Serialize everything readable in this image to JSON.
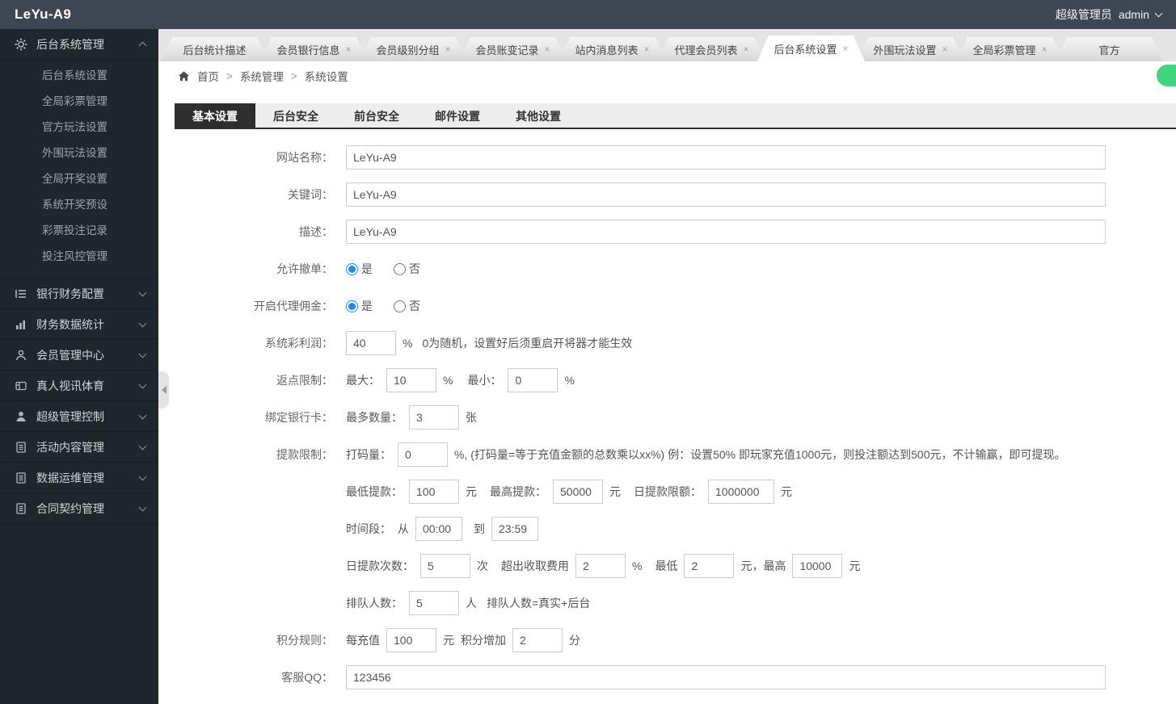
{
  "topbar": {
    "brand": "LeYu-A9",
    "role": "超级管理员",
    "username": "admin"
  },
  "tabbar": {
    "close_glyph": "×",
    "items": [
      {
        "label": "后台统计描述"
      },
      {
        "label": "会员银行信息"
      },
      {
        "label": "会员级别分组"
      },
      {
        "label": "会员账变记录"
      },
      {
        "label": "站内消息列表"
      },
      {
        "label": "代理会员列表"
      },
      {
        "label": "后台系统设置"
      },
      {
        "label": "外围玩法设置"
      },
      {
        "label": "全局彩票管理"
      },
      {
        "label": "官方"
      }
    ],
    "active_label": "后台系统设置"
  },
  "breadcrumb": {
    "separator": ">",
    "items": [
      "首页",
      "系统管理",
      "系统设置"
    ]
  },
  "sidebar": {
    "sections": [
      {
        "label": "后台系统管理",
        "icon": "gear-icon",
        "expanded": true,
        "children": [
          "后台系统设置",
          "全局彩票管理",
          "官方玩法设置",
          "外围玩法设置",
          "全局开奖设置",
          "系统开奖预设",
          "彩票投注记录",
          "投注风控管理"
        ]
      },
      {
        "label": "银行财务配置",
        "icon": "list-icon"
      },
      {
        "label": "财务数据统计",
        "icon": "chart-icon"
      },
      {
        "label": "会员管理中心",
        "icon": "member-icon"
      },
      {
        "label": "真人视讯体育",
        "icon": "video-icon"
      },
      {
        "label": "超级管理控制",
        "icon": "admin-icon"
      },
      {
        "label": "活动内容管理",
        "icon": "doc-icon"
      },
      {
        "label": "数据运维管理",
        "icon": "doc-icon"
      },
      {
        "label": "合同契约管理",
        "icon": "doc-icon"
      }
    ]
  },
  "form_tabs": {
    "items": [
      "基本设置",
      "后台安全",
      "前台安全",
      "邮件设置",
      "其他设置"
    ],
    "active": "基本设置"
  },
  "form": {
    "site_name_label": "网站名称：",
    "site_name_value": "LeYu-A9",
    "keywords_label": "关键词：",
    "keywords_value": "LeYu-A9",
    "desc_label": "描述：",
    "desc_value": "LeYu-A9",
    "allow_cancel_label": "允许撤单：",
    "agent_commission_label": "开启代理佣金：",
    "yes": "是",
    "no": "否",
    "profit_label": "系统彩利润：",
    "profit_value": "40",
    "percent": "%",
    "profit_hint": "0为随机，设置好后须重启开将器才能生效",
    "rebate_label": "返点限制：",
    "rebate_max_label": "最大：",
    "rebate_max_value": "10",
    "rebate_min_label": "最小：",
    "rebate_min_value": "0",
    "bankcard_label": "绑定银行卡：",
    "bankcard_max_label": "最多数量：",
    "bankcard_max_value": "3",
    "bankcard_unit": "张",
    "withdraw_label": "提款限制：",
    "dama_label": "打码量：",
    "dama_value": "0",
    "dama_hint": "%, (打码量=等于充值金额的总数乘以xx%) 例：设置50% 即玩家充值1000元，则投注额达到500元，不计输赢，即可提现。",
    "min_withdraw_label": "最低提款：",
    "min_withdraw_value": "100",
    "yuan": "元",
    "max_withdraw_label": "最高提款：",
    "max_withdraw_value": "50000",
    "daily_limit_label": "日提款限额：",
    "daily_limit_value": "1000000",
    "time_label": "时间段：",
    "time_from_label": "从",
    "time_from_value": "00:00",
    "time_to_label": "到",
    "time_to_value": "23:59",
    "daily_times_label": "日提款次数：",
    "daily_times_value": "5",
    "times_unit": "次",
    "overfee_label": "超出收取费用",
    "overfee_value": "2",
    "fee_min_label": "最低",
    "fee_min_value": "2",
    "fee_between": "元，最高",
    "fee_max_value": "10000",
    "queue_label": "排队人数：",
    "queue_value": "5",
    "queue_unit": "人",
    "queue_hint": "排队人数=真实+后台",
    "points_label": "积分规则：",
    "points_per_label": "每充值",
    "points_per_value": "100",
    "points_add_label": "积分增加",
    "points_add_value": "2",
    "points_add_unit": "分",
    "qq_label": "客服QQ：",
    "qq_value": "123456"
  }
}
